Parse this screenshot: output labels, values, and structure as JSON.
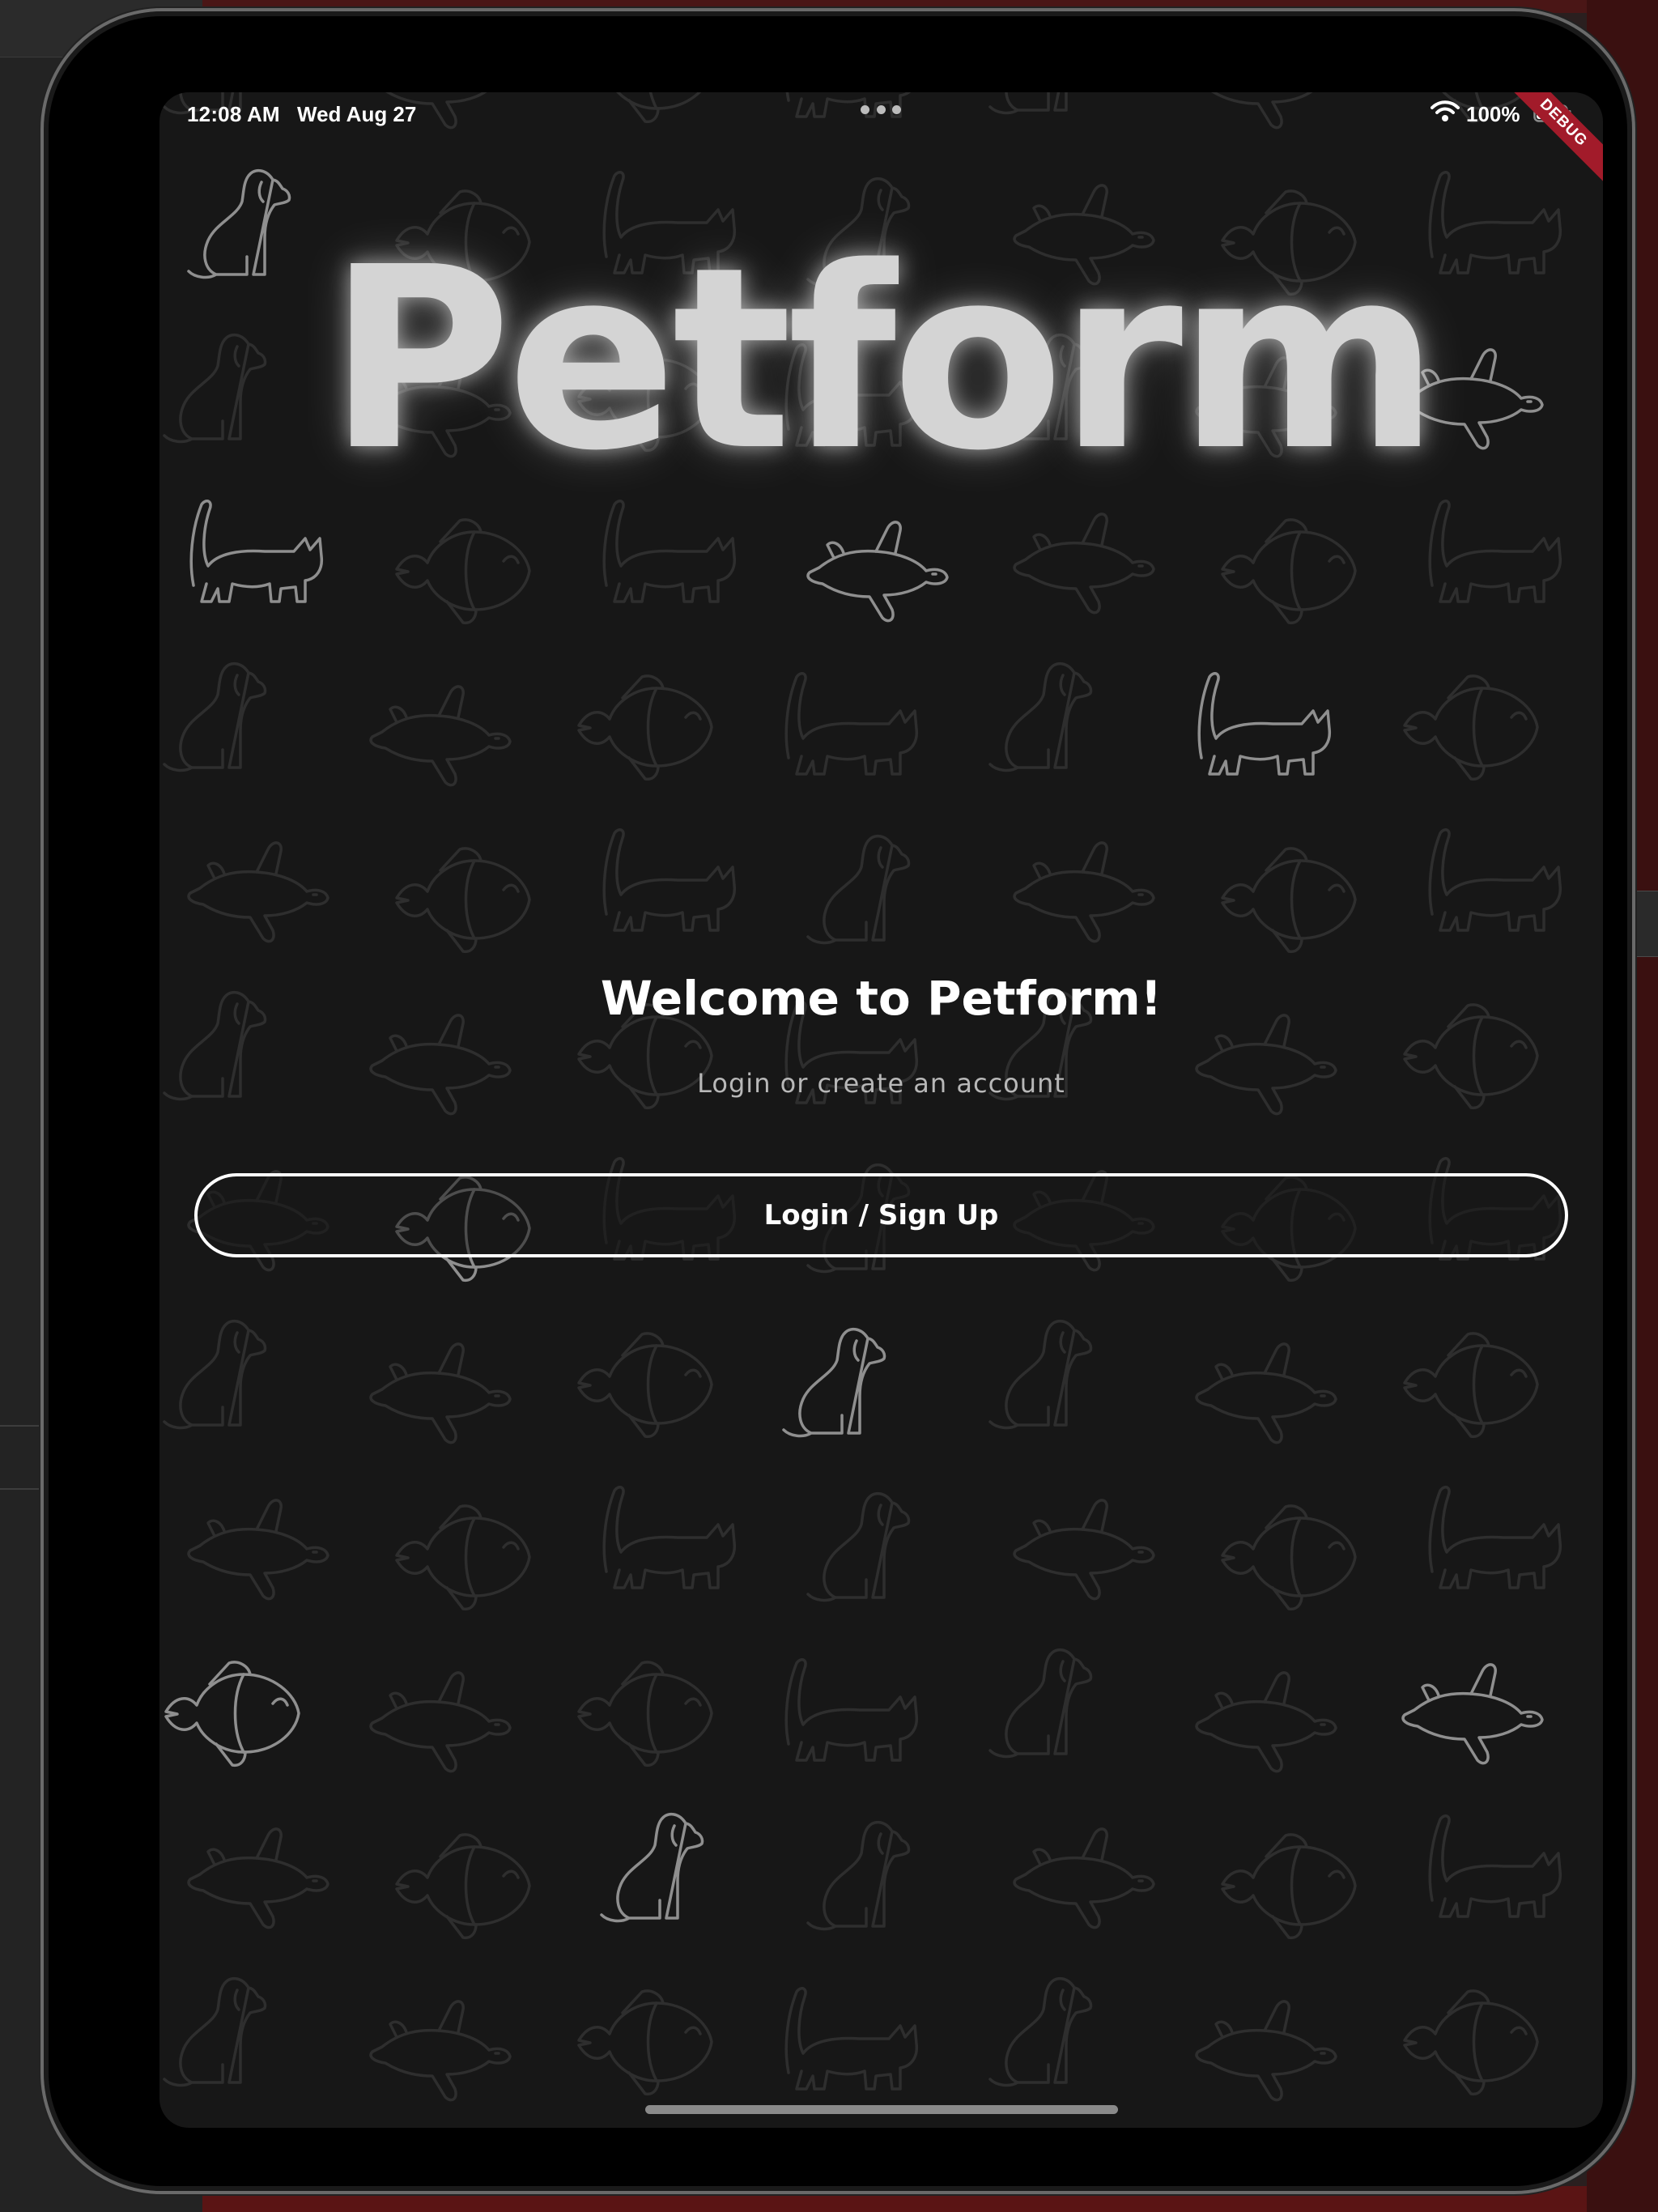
{
  "status_bar": {
    "time": "12:08 AM",
    "date": "Wed Aug 27",
    "battery": "100%"
  },
  "debug_banner": "DEBUG",
  "app": {
    "logo": "Petform",
    "welcome_title": "Welcome to Petform!",
    "subtitle": "Login or create an account",
    "login_button": "Login / Sign Up"
  },
  "background_icons": [
    "dog-icon",
    "cat-icon",
    "fish-icon",
    "turtle-icon"
  ],
  "colors": {
    "background": "#171717",
    "text": "#ffffff",
    "subtitle": "#b8b8b8",
    "debug_banner": "#a21b2a"
  }
}
